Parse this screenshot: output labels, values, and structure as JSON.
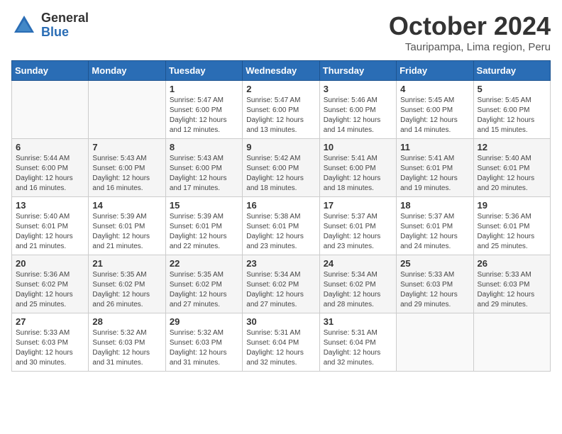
{
  "header": {
    "logo": {
      "general": "General",
      "blue": "Blue"
    },
    "title": "October 2024",
    "subtitle": "Tauripampa, Lima region, Peru"
  },
  "weekdays": [
    "Sunday",
    "Monday",
    "Tuesday",
    "Wednesday",
    "Thursday",
    "Friday",
    "Saturday"
  ],
  "weeks": [
    [
      {
        "day": "",
        "sunrise": "",
        "sunset": "",
        "daylight": ""
      },
      {
        "day": "",
        "sunrise": "",
        "sunset": "",
        "daylight": ""
      },
      {
        "day": "1",
        "sunrise": "Sunrise: 5:47 AM",
        "sunset": "Sunset: 6:00 PM",
        "daylight": "Daylight: 12 hours and 12 minutes."
      },
      {
        "day": "2",
        "sunrise": "Sunrise: 5:47 AM",
        "sunset": "Sunset: 6:00 PM",
        "daylight": "Daylight: 12 hours and 13 minutes."
      },
      {
        "day": "3",
        "sunrise": "Sunrise: 5:46 AM",
        "sunset": "Sunset: 6:00 PM",
        "daylight": "Daylight: 12 hours and 14 minutes."
      },
      {
        "day": "4",
        "sunrise": "Sunrise: 5:45 AM",
        "sunset": "Sunset: 6:00 PM",
        "daylight": "Daylight: 12 hours and 14 minutes."
      },
      {
        "day": "5",
        "sunrise": "Sunrise: 5:45 AM",
        "sunset": "Sunset: 6:00 PM",
        "daylight": "Daylight: 12 hours and 15 minutes."
      }
    ],
    [
      {
        "day": "6",
        "sunrise": "Sunrise: 5:44 AM",
        "sunset": "Sunset: 6:00 PM",
        "daylight": "Daylight: 12 hours and 16 minutes."
      },
      {
        "day": "7",
        "sunrise": "Sunrise: 5:43 AM",
        "sunset": "Sunset: 6:00 PM",
        "daylight": "Daylight: 12 hours and 16 minutes."
      },
      {
        "day": "8",
        "sunrise": "Sunrise: 5:43 AM",
        "sunset": "Sunset: 6:00 PM",
        "daylight": "Daylight: 12 hours and 17 minutes."
      },
      {
        "day": "9",
        "sunrise": "Sunrise: 5:42 AM",
        "sunset": "Sunset: 6:00 PM",
        "daylight": "Daylight: 12 hours and 18 minutes."
      },
      {
        "day": "10",
        "sunrise": "Sunrise: 5:41 AM",
        "sunset": "Sunset: 6:00 PM",
        "daylight": "Daylight: 12 hours and 18 minutes."
      },
      {
        "day": "11",
        "sunrise": "Sunrise: 5:41 AM",
        "sunset": "Sunset: 6:01 PM",
        "daylight": "Daylight: 12 hours and 19 minutes."
      },
      {
        "day": "12",
        "sunrise": "Sunrise: 5:40 AM",
        "sunset": "Sunset: 6:01 PM",
        "daylight": "Daylight: 12 hours and 20 minutes."
      }
    ],
    [
      {
        "day": "13",
        "sunrise": "Sunrise: 5:40 AM",
        "sunset": "Sunset: 6:01 PM",
        "daylight": "Daylight: 12 hours and 21 minutes."
      },
      {
        "day": "14",
        "sunrise": "Sunrise: 5:39 AM",
        "sunset": "Sunset: 6:01 PM",
        "daylight": "Daylight: 12 hours and 21 minutes."
      },
      {
        "day": "15",
        "sunrise": "Sunrise: 5:39 AM",
        "sunset": "Sunset: 6:01 PM",
        "daylight": "Daylight: 12 hours and 22 minutes."
      },
      {
        "day": "16",
        "sunrise": "Sunrise: 5:38 AM",
        "sunset": "Sunset: 6:01 PM",
        "daylight": "Daylight: 12 hours and 23 minutes."
      },
      {
        "day": "17",
        "sunrise": "Sunrise: 5:37 AM",
        "sunset": "Sunset: 6:01 PM",
        "daylight": "Daylight: 12 hours and 23 minutes."
      },
      {
        "day": "18",
        "sunrise": "Sunrise: 5:37 AM",
        "sunset": "Sunset: 6:01 PM",
        "daylight": "Daylight: 12 hours and 24 minutes."
      },
      {
        "day": "19",
        "sunrise": "Sunrise: 5:36 AM",
        "sunset": "Sunset: 6:01 PM",
        "daylight": "Daylight: 12 hours and 25 minutes."
      }
    ],
    [
      {
        "day": "20",
        "sunrise": "Sunrise: 5:36 AM",
        "sunset": "Sunset: 6:02 PM",
        "daylight": "Daylight: 12 hours and 25 minutes."
      },
      {
        "day": "21",
        "sunrise": "Sunrise: 5:35 AM",
        "sunset": "Sunset: 6:02 PM",
        "daylight": "Daylight: 12 hours and 26 minutes."
      },
      {
        "day": "22",
        "sunrise": "Sunrise: 5:35 AM",
        "sunset": "Sunset: 6:02 PM",
        "daylight": "Daylight: 12 hours and 27 minutes."
      },
      {
        "day": "23",
        "sunrise": "Sunrise: 5:34 AM",
        "sunset": "Sunset: 6:02 PM",
        "daylight": "Daylight: 12 hours and 27 minutes."
      },
      {
        "day": "24",
        "sunrise": "Sunrise: 5:34 AM",
        "sunset": "Sunset: 6:02 PM",
        "daylight": "Daylight: 12 hours and 28 minutes."
      },
      {
        "day": "25",
        "sunrise": "Sunrise: 5:33 AM",
        "sunset": "Sunset: 6:03 PM",
        "daylight": "Daylight: 12 hours and 29 minutes."
      },
      {
        "day": "26",
        "sunrise": "Sunrise: 5:33 AM",
        "sunset": "Sunset: 6:03 PM",
        "daylight": "Daylight: 12 hours and 29 minutes."
      }
    ],
    [
      {
        "day": "27",
        "sunrise": "Sunrise: 5:33 AM",
        "sunset": "Sunset: 6:03 PM",
        "daylight": "Daylight: 12 hours and 30 minutes."
      },
      {
        "day": "28",
        "sunrise": "Sunrise: 5:32 AM",
        "sunset": "Sunset: 6:03 PM",
        "daylight": "Daylight: 12 hours and 31 minutes."
      },
      {
        "day": "29",
        "sunrise": "Sunrise: 5:32 AM",
        "sunset": "Sunset: 6:03 PM",
        "daylight": "Daylight: 12 hours and 31 minutes."
      },
      {
        "day": "30",
        "sunrise": "Sunrise: 5:31 AM",
        "sunset": "Sunset: 6:04 PM",
        "daylight": "Daylight: 12 hours and 32 minutes."
      },
      {
        "day": "31",
        "sunrise": "Sunrise: 5:31 AM",
        "sunset": "Sunset: 6:04 PM",
        "daylight": "Daylight: 12 hours and 32 minutes."
      },
      {
        "day": "",
        "sunrise": "",
        "sunset": "",
        "daylight": ""
      },
      {
        "day": "",
        "sunrise": "",
        "sunset": "",
        "daylight": ""
      }
    ]
  ]
}
